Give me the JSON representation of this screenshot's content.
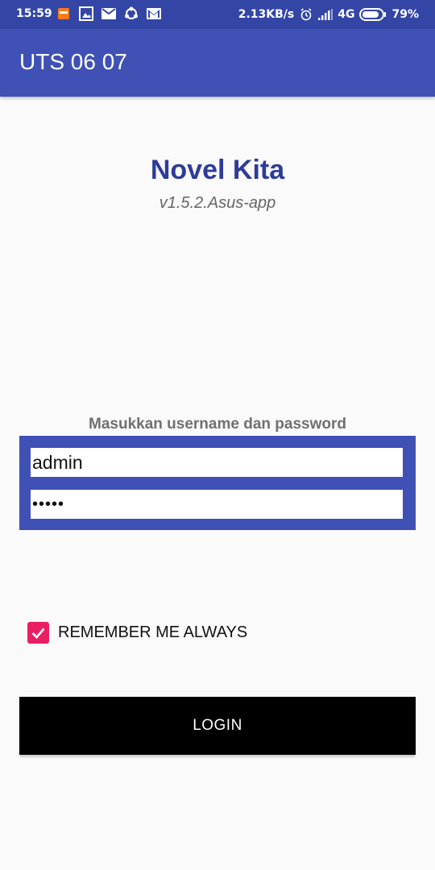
{
  "status_bar": {
    "time": "15:59",
    "network_speed": "2.13KB/s",
    "network_type": "4G",
    "battery": "79%",
    "left_icons": [
      "calendar-icon",
      "photo-icon",
      "mail-icon",
      "share-icon",
      "gmail-icon"
    ],
    "right_icons": [
      "alarm-icon",
      "signal-icon",
      "battery-icon"
    ]
  },
  "app_bar": {
    "title": "UTS 06 07"
  },
  "brand": {
    "title": "Novel Kita",
    "version": "v1.5.2.Asus-app"
  },
  "login_form": {
    "prompt": "Masukkan username dan password",
    "username_value": "admin",
    "password_value": "admin"
  },
  "remember": {
    "label": "REMEMBER ME ALWAYS",
    "checked": true
  },
  "login_button": {
    "label": "LOGIN"
  },
  "colors": {
    "status_bar": "#3346a6",
    "primary": "#3f51b5",
    "brand_title": "#2e3c98",
    "accent": "#e91e63",
    "button": "#000000",
    "background": "#fafafa"
  }
}
